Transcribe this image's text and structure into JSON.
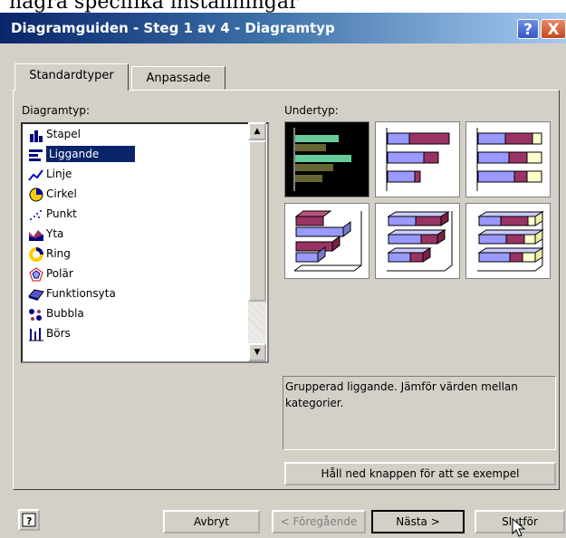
{
  "background_text": "några specifika inställningar",
  "window": {
    "title": "Diagramguiden - Steg 1 av 4 - Diagramtyp",
    "help_glyph": "?",
    "close_glyph": "X"
  },
  "tabs": [
    {
      "label": "Standardtyper",
      "active": true
    },
    {
      "label": "Anpassade",
      "active": false
    }
  ],
  "chart_type_list": {
    "label": "Diagramtyp:",
    "selected": "Liggande",
    "items": [
      {
        "label": "Stapel",
        "icon": "column-chart-icon"
      },
      {
        "label": "Liggande",
        "icon": "bar-chart-icon"
      },
      {
        "label": "Linje",
        "icon": "line-chart-icon"
      },
      {
        "label": "Cirkel",
        "icon": "pie-chart-icon"
      },
      {
        "label": "Punkt",
        "icon": "scatter-chart-icon"
      },
      {
        "label": "Yta",
        "icon": "area-chart-icon"
      },
      {
        "label": "Ring",
        "icon": "doughnut-chart-icon"
      },
      {
        "label": "Polär",
        "icon": "radar-chart-icon"
      },
      {
        "label": "Funktionsyta",
        "icon": "surface-chart-icon"
      },
      {
        "label": "Bubbla",
        "icon": "bubble-chart-icon"
      },
      {
        "label": "Börs",
        "icon": "stock-chart-icon"
      }
    ]
  },
  "subtype": {
    "label": "Undertyp:",
    "selected_index": 0,
    "options": [
      "clustered-bar-icon",
      "stacked-bar-icon",
      "100-stacked-bar-icon",
      "3d-clustered-bar-icon",
      "3d-stacked-bar-icon",
      "3d-100-stacked-bar-icon"
    ],
    "description": "Grupperad liggande. Jämför värden mellan kategorier."
  },
  "buttons": {
    "preview": "Håll ned knappen för att se exempel",
    "cancel": "Avbryt",
    "back": "< Föregående",
    "next": "Nästa >",
    "finish": "Slutför"
  },
  "colors": {
    "title_start": "#0a246a",
    "title_end": "#a6caf0",
    "selection": "#0a246a",
    "dialog": "#d4d0c8",
    "bar_purple": "#993366",
    "bar_lavender": "#9999ff",
    "bar_cream": "#ffffcc"
  }
}
